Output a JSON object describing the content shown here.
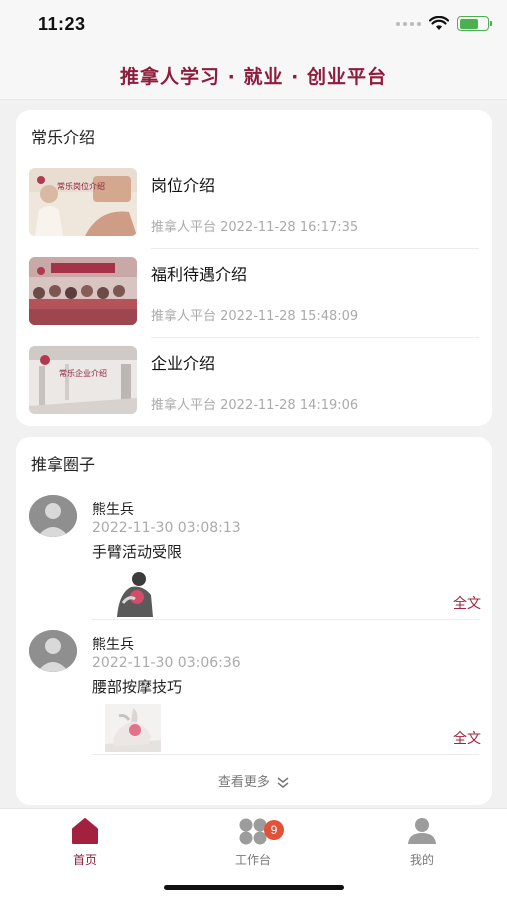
{
  "status_bar": {
    "time": "11:23"
  },
  "header": {
    "title": "推拿人学习 · 就业 · 创业平台"
  },
  "intro_section": {
    "title": "常乐介绍",
    "articles": [
      {
        "title": "岗位介绍",
        "meta": "推拿人平台 2022-11-28 16:17:35",
        "thumb_caption": "常乐岗位介绍"
      },
      {
        "title": "福利待遇介绍",
        "meta": "推拿人平台 2022-11-28 15:48:09"
      },
      {
        "title": "企业介绍",
        "meta": "推拿人平台 2022-11-28 14:19:06",
        "thumb_caption": "常乐企业介绍"
      }
    ]
  },
  "circle_section": {
    "title": "推拿圈子",
    "posts": [
      {
        "author": "熊生兵",
        "time": "2022-11-30 03:08:13",
        "text": "手臂活动受限",
        "more_label": "全文"
      },
      {
        "author": "熊生兵",
        "time": "2022-11-30 03:06:36",
        "text": "腰部按摩技巧",
        "more_label": "全文"
      }
    ],
    "view_more_label": "查看更多",
    "view_more_icon": "double-chevron-down-icon"
  },
  "tab_bar": {
    "tabs": [
      {
        "label": "首页",
        "icon": "home-icon",
        "active": true
      },
      {
        "label": "工作台",
        "icon": "apps-icon",
        "badge": "9"
      },
      {
        "label": "我的",
        "icon": "person-icon"
      }
    ]
  },
  "colors": {
    "brand": "#8e1c3c",
    "badge": "#e0533b",
    "accent_link": "#a0243f"
  }
}
